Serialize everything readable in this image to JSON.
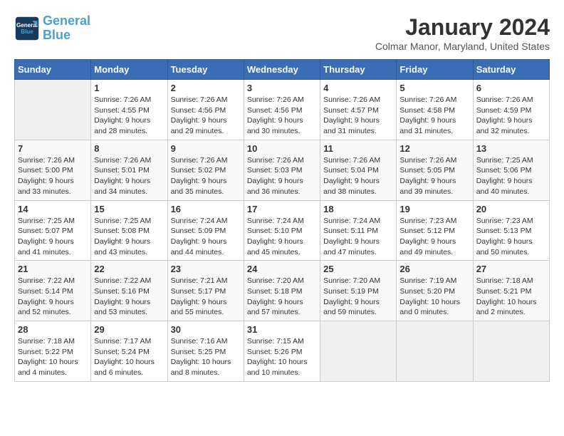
{
  "header": {
    "logo_line1": "General",
    "logo_line2": "Blue",
    "month": "January 2024",
    "location": "Colmar Manor, Maryland, United States"
  },
  "days_of_week": [
    "Sunday",
    "Monday",
    "Tuesday",
    "Wednesday",
    "Thursday",
    "Friday",
    "Saturday"
  ],
  "weeks": [
    [
      {
        "day": "",
        "sunrise": "",
        "sunset": "",
        "daylight": ""
      },
      {
        "day": "1",
        "sunrise": "Sunrise: 7:26 AM",
        "sunset": "Sunset: 4:55 PM",
        "daylight": "Daylight: 9 hours and 28 minutes."
      },
      {
        "day": "2",
        "sunrise": "Sunrise: 7:26 AM",
        "sunset": "Sunset: 4:56 PM",
        "daylight": "Daylight: 9 hours and 29 minutes."
      },
      {
        "day": "3",
        "sunrise": "Sunrise: 7:26 AM",
        "sunset": "Sunset: 4:56 PM",
        "daylight": "Daylight: 9 hours and 30 minutes."
      },
      {
        "day": "4",
        "sunrise": "Sunrise: 7:26 AM",
        "sunset": "Sunset: 4:57 PM",
        "daylight": "Daylight: 9 hours and 31 minutes."
      },
      {
        "day": "5",
        "sunrise": "Sunrise: 7:26 AM",
        "sunset": "Sunset: 4:58 PM",
        "daylight": "Daylight: 9 hours and 31 minutes."
      },
      {
        "day": "6",
        "sunrise": "Sunrise: 7:26 AM",
        "sunset": "Sunset: 4:59 PM",
        "daylight": "Daylight: 9 hours and 32 minutes."
      }
    ],
    [
      {
        "day": "7",
        "sunrise": "Sunrise: 7:26 AM",
        "sunset": "Sunset: 5:00 PM",
        "daylight": "Daylight: 9 hours and 33 minutes."
      },
      {
        "day": "8",
        "sunrise": "Sunrise: 7:26 AM",
        "sunset": "Sunset: 5:01 PM",
        "daylight": "Daylight: 9 hours and 34 minutes."
      },
      {
        "day": "9",
        "sunrise": "Sunrise: 7:26 AM",
        "sunset": "Sunset: 5:02 PM",
        "daylight": "Daylight: 9 hours and 35 minutes."
      },
      {
        "day": "10",
        "sunrise": "Sunrise: 7:26 AM",
        "sunset": "Sunset: 5:03 PM",
        "daylight": "Daylight: 9 hours and 36 minutes."
      },
      {
        "day": "11",
        "sunrise": "Sunrise: 7:26 AM",
        "sunset": "Sunset: 5:04 PM",
        "daylight": "Daylight: 9 hours and 38 minutes."
      },
      {
        "day": "12",
        "sunrise": "Sunrise: 7:26 AM",
        "sunset": "Sunset: 5:05 PM",
        "daylight": "Daylight: 9 hours and 39 minutes."
      },
      {
        "day": "13",
        "sunrise": "Sunrise: 7:25 AM",
        "sunset": "Sunset: 5:06 PM",
        "daylight": "Daylight: 9 hours and 40 minutes."
      }
    ],
    [
      {
        "day": "14",
        "sunrise": "Sunrise: 7:25 AM",
        "sunset": "Sunset: 5:07 PM",
        "daylight": "Daylight: 9 hours and 41 minutes."
      },
      {
        "day": "15",
        "sunrise": "Sunrise: 7:25 AM",
        "sunset": "Sunset: 5:08 PM",
        "daylight": "Daylight: 9 hours and 43 minutes."
      },
      {
        "day": "16",
        "sunrise": "Sunrise: 7:24 AM",
        "sunset": "Sunset: 5:09 PM",
        "daylight": "Daylight: 9 hours and 44 minutes."
      },
      {
        "day": "17",
        "sunrise": "Sunrise: 7:24 AM",
        "sunset": "Sunset: 5:10 PM",
        "daylight": "Daylight: 9 hours and 45 minutes."
      },
      {
        "day": "18",
        "sunrise": "Sunrise: 7:24 AM",
        "sunset": "Sunset: 5:11 PM",
        "daylight": "Daylight: 9 hours and 47 minutes."
      },
      {
        "day": "19",
        "sunrise": "Sunrise: 7:23 AM",
        "sunset": "Sunset: 5:12 PM",
        "daylight": "Daylight: 9 hours and 49 minutes."
      },
      {
        "day": "20",
        "sunrise": "Sunrise: 7:23 AM",
        "sunset": "Sunset: 5:13 PM",
        "daylight": "Daylight: 9 hours and 50 minutes."
      }
    ],
    [
      {
        "day": "21",
        "sunrise": "Sunrise: 7:22 AM",
        "sunset": "Sunset: 5:14 PM",
        "daylight": "Daylight: 9 hours and 52 minutes."
      },
      {
        "day": "22",
        "sunrise": "Sunrise: 7:22 AM",
        "sunset": "Sunset: 5:16 PM",
        "daylight": "Daylight: 9 hours and 53 minutes."
      },
      {
        "day": "23",
        "sunrise": "Sunrise: 7:21 AM",
        "sunset": "Sunset: 5:17 PM",
        "daylight": "Daylight: 9 hours and 55 minutes."
      },
      {
        "day": "24",
        "sunrise": "Sunrise: 7:20 AM",
        "sunset": "Sunset: 5:18 PM",
        "daylight": "Daylight: 9 hours and 57 minutes."
      },
      {
        "day": "25",
        "sunrise": "Sunrise: 7:20 AM",
        "sunset": "Sunset: 5:19 PM",
        "daylight": "Daylight: 9 hours and 59 minutes."
      },
      {
        "day": "26",
        "sunrise": "Sunrise: 7:19 AM",
        "sunset": "Sunset: 5:20 PM",
        "daylight": "Daylight: 10 hours and 0 minutes."
      },
      {
        "day": "27",
        "sunrise": "Sunrise: 7:18 AM",
        "sunset": "Sunset: 5:21 PM",
        "daylight": "Daylight: 10 hours and 2 minutes."
      }
    ],
    [
      {
        "day": "28",
        "sunrise": "Sunrise: 7:18 AM",
        "sunset": "Sunset: 5:22 PM",
        "daylight": "Daylight: 10 hours and 4 minutes."
      },
      {
        "day": "29",
        "sunrise": "Sunrise: 7:17 AM",
        "sunset": "Sunset: 5:24 PM",
        "daylight": "Daylight: 10 hours and 6 minutes."
      },
      {
        "day": "30",
        "sunrise": "Sunrise: 7:16 AM",
        "sunset": "Sunset: 5:25 PM",
        "daylight": "Daylight: 10 hours and 8 minutes."
      },
      {
        "day": "31",
        "sunrise": "Sunrise: 7:15 AM",
        "sunset": "Sunset: 5:26 PM",
        "daylight": "Daylight: 10 hours and 10 minutes."
      },
      {
        "day": "",
        "sunrise": "",
        "sunset": "",
        "daylight": ""
      },
      {
        "day": "",
        "sunrise": "",
        "sunset": "",
        "daylight": ""
      },
      {
        "day": "",
        "sunrise": "",
        "sunset": "",
        "daylight": ""
      }
    ]
  ]
}
